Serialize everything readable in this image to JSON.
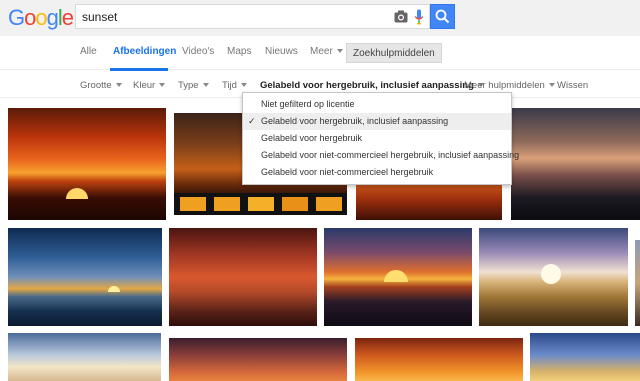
{
  "header": {
    "logo": [
      "G",
      "o",
      "o",
      "g",
      "l",
      "e"
    ],
    "logo_colors": [
      "#4285f4",
      "#ea4335",
      "#fbbc05",
      "#4285f4",
      "#34a853",
      "#ea4335"
    ],
    "search_value": "sunset"
  },
  "tabs": {
    "items": [
      "Alle",
      "Afbeeldingen",
      "Video's",
      "Maps",
      "Nieuws",
      "Meer"
    ],
    "tools_label": "Zoekhulpmiddelen"
  },
  "tools_row": {
    "items": [
      "Grootte",
      "Kleur",
      "Type",
      "Tijd",
      "Gelabeld voor hergebruik, inclusief aanpassing",
      "Meer hulpmiddelen",
      "Wissen"
    ]
  },
  "dropdown": {
    "items": [
      "Niet gefilterd op licentie",
      "Gelabeld voor hergebruik, inclusief aanpassing",
      "Gelabeld voor hergebruik",
      "Gelabeld voor niet-commercieel hergebruik, inclusief aanpassing",
      "Gelabeld voor niet-commercieel hergebruik"
    ],
    "checked_index": 1,
    "check_mark": "✓"
  },
  "colors": {
    "accent": "#1a73e8",
    "search_button": "#4285f4"
  }
}
